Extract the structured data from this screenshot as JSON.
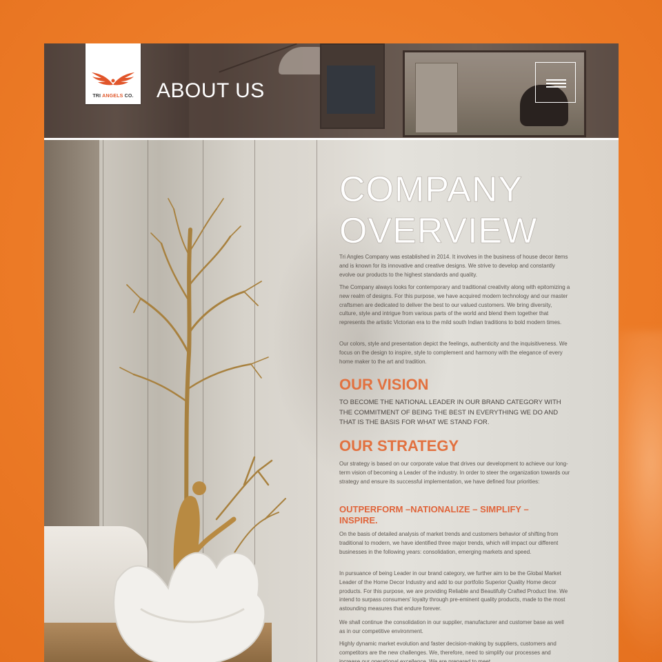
{
  "colors": {
    "background": "#ef7d2a",
    "accent": "#e2713f",
    "title_white": "#ffffff",
    "body_text": "#5c5650"
  },
  "header": {
    "logo_text_prefix": "TRI",
    "logo_text_accent": "ANGELS",
    "logo_text_suffix": " CO.",
    "title": "ABOUT US",
    "menu_icon": "hamburger-icon"
  },
  "content": {
    "overview_title_line1": "COMPANY",
    "overview_title_line2": "OVERVIEW",
    "overview_paragraphs": [
      "Tri Angles Company was established in 2014. It involves in the business of house decor items and is known for its innovative and creative designs. We strive to develop and constantly evolve our products to the highest standards and quality.",
      "The Company always looks for contemporary and traditional creativity along with epitomizing a new realm of designs. For this purpose, we have acquired modern technology and our master craftsmen are dedicated to deliver the best to our valued customers. We bring diversity, culture, style and intrigue from various parts of the world and blend them together that represents the artistic Victorian era to the mild south Indian traditions to bold modern times.",
      "Our colors, style and presentation depict the feelings, authenticity and the inquisitiveness. We focus on the design to inspire, style to complement and harmony with the elegance of every home maker to the art and tradition."
    ],
    "vision_heading": "OUR VISION",
    "vision_text": "TO BECOME THE NATIONAL LEADER IN OUR BRAND CATEGORY WITH THE COMMITMENT OF BEING THE BEST IN EVERYTHING WE DO AND THAT IS THE BASIS FOR WHAT WE STAND FOR.",
    "strategy_heading": "OUR STRATEGY",
    "strategy_text": "Our strategy is based on our corporate value that drives our development to achieve our long-term vision of becoming a Leader of the industry. In order to steer the organization towards our strategy and ensure its successful implementation, we have defined four priorities:",
    "priorities_heading": "OUTPERFORM –NATIONALIZE – SIMPLIFY – INSPIRE.",
    "priorities_paragraphs": [
      "On the basis of detailed analysis of market trends and customers behavior of shifting from traditional to modern, we have identified three major trends, which will impact our different businesses in the following years: consolidation, emerging markets and speed.",
      "In pursuance of being Leader in our brand category, we further aim to be the Global Market Leader of the Home Decor Industry and add to our portfolio Superior Quality Home decor products. For this purpose, we are providing Reliable and Beautifully Crafted Product line. We intend to surpass consumers' loyalty through pre-eminent quality products, made to the most astounding measures that endure forever.",
      "We shall continue the consolidation in our supplier, manufacturer and customer base as well as in our competitive environment.",
      "Highly dynamic market evolution and faster decision-making by suppliers, customers and competitors are the new challenges. We, therefore, need to simplify our processes and increase our operational excellence. We are prepared to meet"
    ]
  }
}
